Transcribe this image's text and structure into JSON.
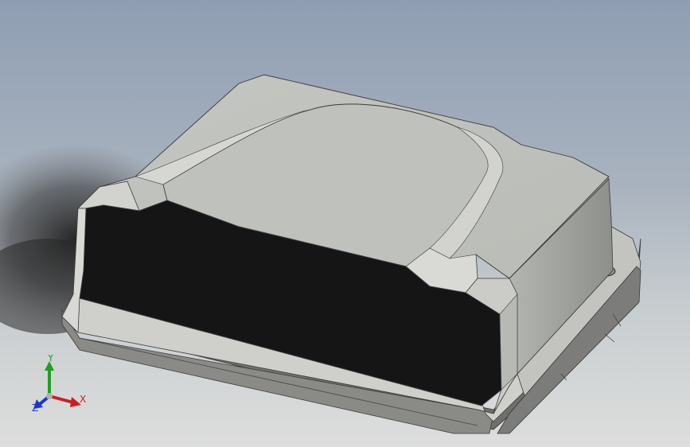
{
  "viewport": {
    "background_top": "#8f9eb3",
    "background_bottom": "#dddedd",
    "model": {
      "body_color": "#c9cac4",
      "side_color": "#a9aba6",
      "cavity_color": "#151515",
      "edge_color": "#3a3a3a"
    }
  },
  "triad": {
    "x_label": "X",
    "y_label": "Y",
    "z_label": "Z",
    "x_color": "#cc1f1f",
    "y_color": "#1fa01f",
    "z_color": "#1f35cc"
  }
}
